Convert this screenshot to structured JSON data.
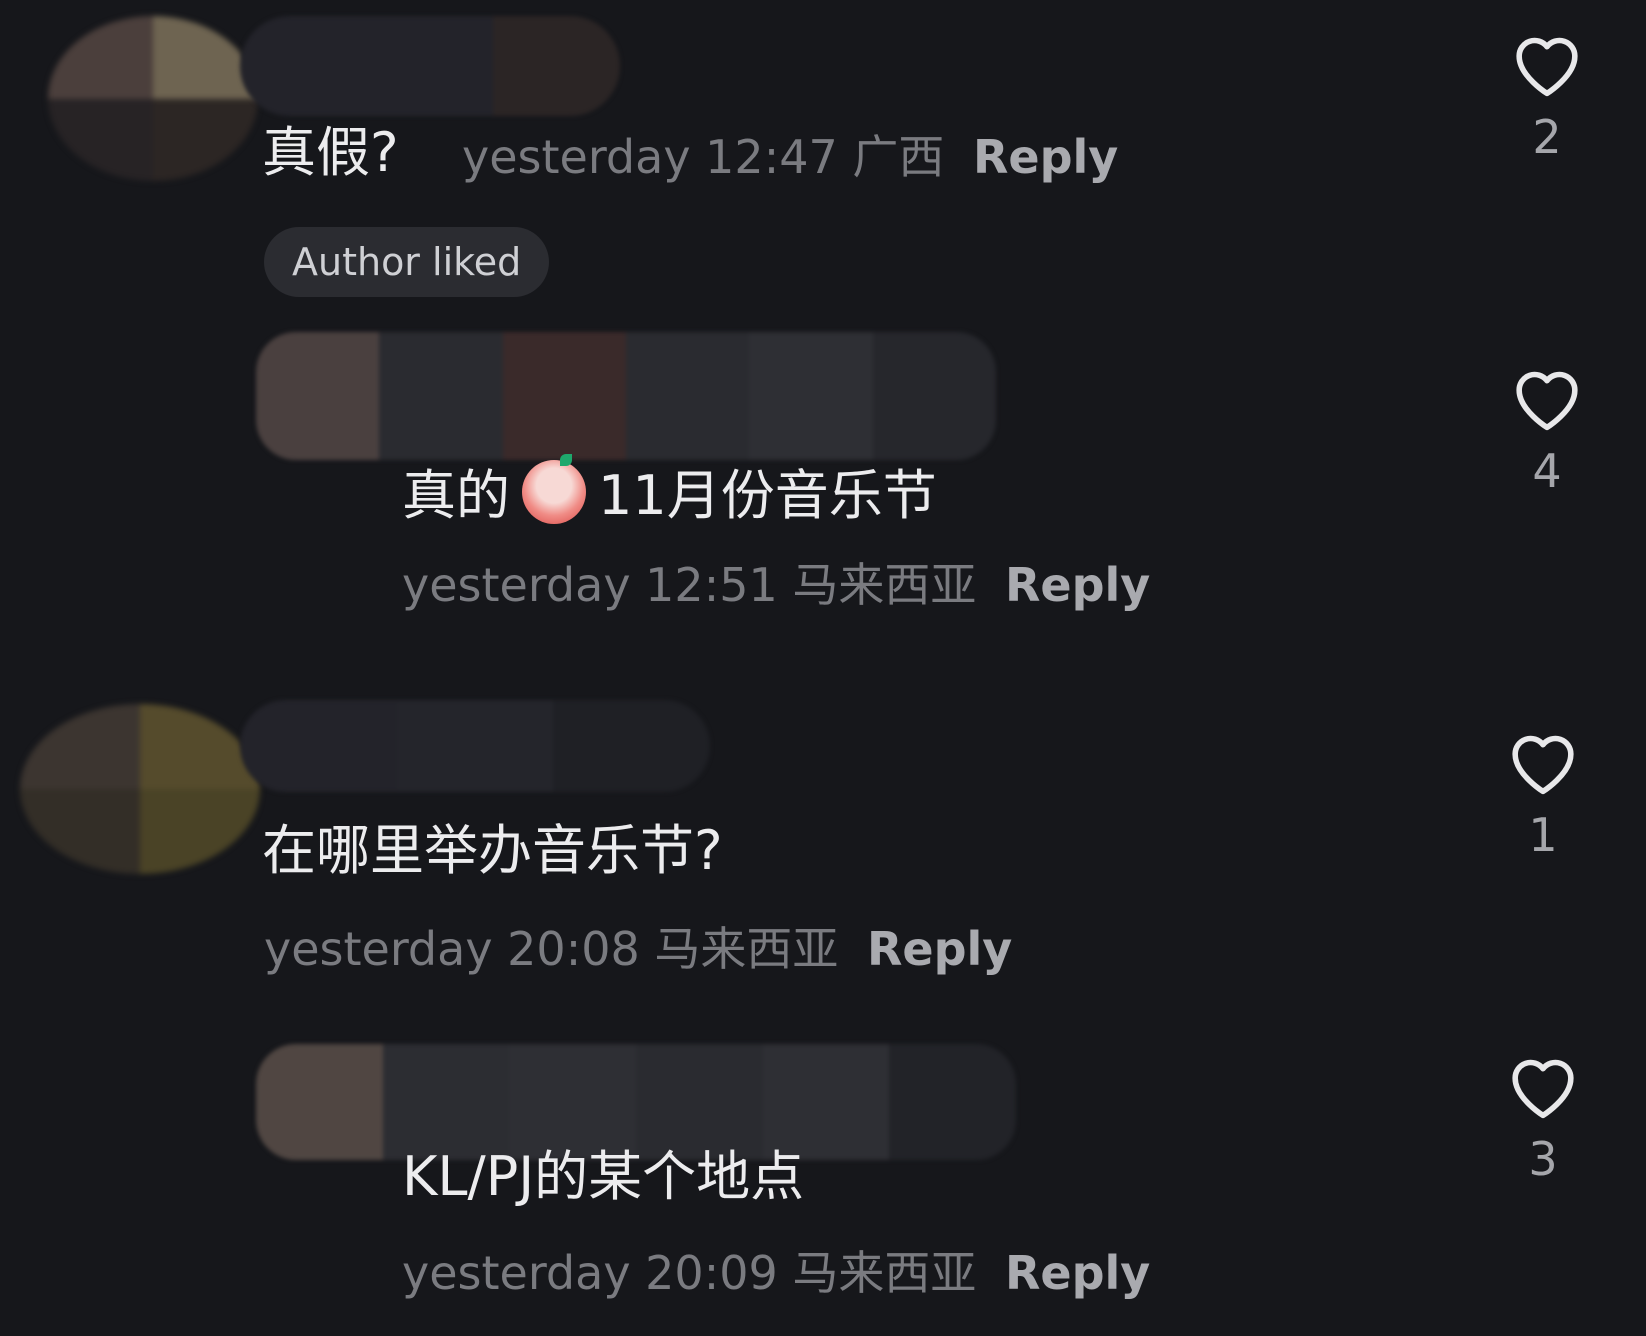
{
  "comments": [
    {
      "text": "真假?",
      "time": "yesterday 12:47",
      "location": "广西",
      "reply_label": "Reply",
      "badge": "Author liked",
      "likes": "2"
    },
    {
      "text_before_emoji": "真的",
      "emoji_name": "praying-emoji-icon",
      "text_after_emoji": "11月份音乐节",
      "time": "yesterday 12:51",
      "location": "马来西亚",
      "reply_label": "Reply",
      "likes": "4"
    },
    {
      "text": "在哪里举办音乐节?",
      "time": "yesterday 20:08",
      "location": "马来西亚",
      "reply_label": "Reply",
      "likes": "1"
    },
    {
      "text": "KL/PJ的某个地点",
      "time": "yesterday 20:09",
      "location": "马来西亚",
      "reply_label": "Reply",
      "likes": "3"
    }
  ],
  "colors": {
    "background": "#16171b",
    "text_primary": "#ececee",
    "text_meta": "#7a7b80",
    "reply": "#a9aaaf"
  }
}
